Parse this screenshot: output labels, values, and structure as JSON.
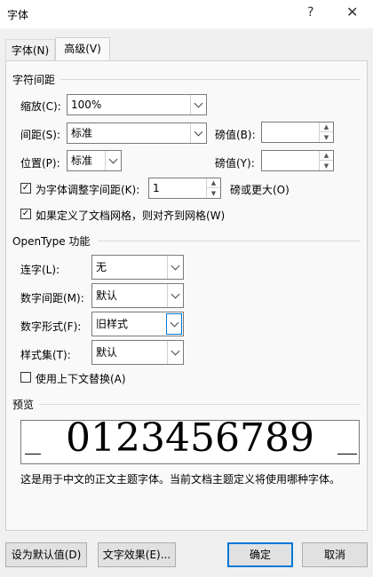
{
  "window": {
    "title": "字体",
    "help_glyph": "?",
    "close_glyph": "✕"
  },
  "tabs": [
    {
      "label": "字体(N)"
    },
    {
      "label": "高级(V)"
    }
  ],
  "char_spacing": {
    "header": "字符间距",
    "scale": {
      "label": "缩放(C):",
      "value": "100%"
    },
    "spacing": {
      "label": "间距(S):",
      "value": "标准",
      "by_label": "磅值(B):",
      "by_value": ""
    },
    "position": {
      "label": "位置(P):",
      "value": "标准",
      "by_label": "磅值(Y):",
      "by_value": ""
    },
    "kerning": {
      "checked": true,
      "label": "为字体调整字间距(K):",
      "value": "1",
      "suffix": "磅或更大(O)"
    },
    "snap_grid": {
      "checked": true,
      "label": "如果定义了文档网格，则对齐到网格(W)"
    }
  },
  "opentype": {
    "header": "OpenType 功能",
    "ligatures": {
      "label": "连字(L):",
      "value": "无"
    },
    "number_spacing": {
      "label": "数字间距(M):",
      "value": "默认"
    },
    "number_forms": {
      "label": "数字形式(F):",
      "value": "旧样式"
    },
    "stylistic_sets": {
      "label": "样式集(T):",
      "value": "默认"
    },
    "contextual_alternates": {
      "checked": false,
      "label": "使用上下文替换(A)"
    }
  },
  "preview": {
    "header": "预览",
    "sample": "0123456789",
    "description": "这是用于中文的正文主题字体。当前文档主题定义将使用哪种字体。"
  },
  "buttons": {
    "set_default": "设为默认值(D)",
    "text_effects": "文字效果(E)...",
    "ok": "确定",
    "cancel": "取消"
  },
  "icons": {
    "check": "✓",
    "spin_up": "▲",
    "spin_down": "▼"
  },
  "colors": {
    "focus_border": "#0078d7",
    "dialog_bg": "#f0f0f0",
    "panel_bg": "#f9f9f9"
  }
}
